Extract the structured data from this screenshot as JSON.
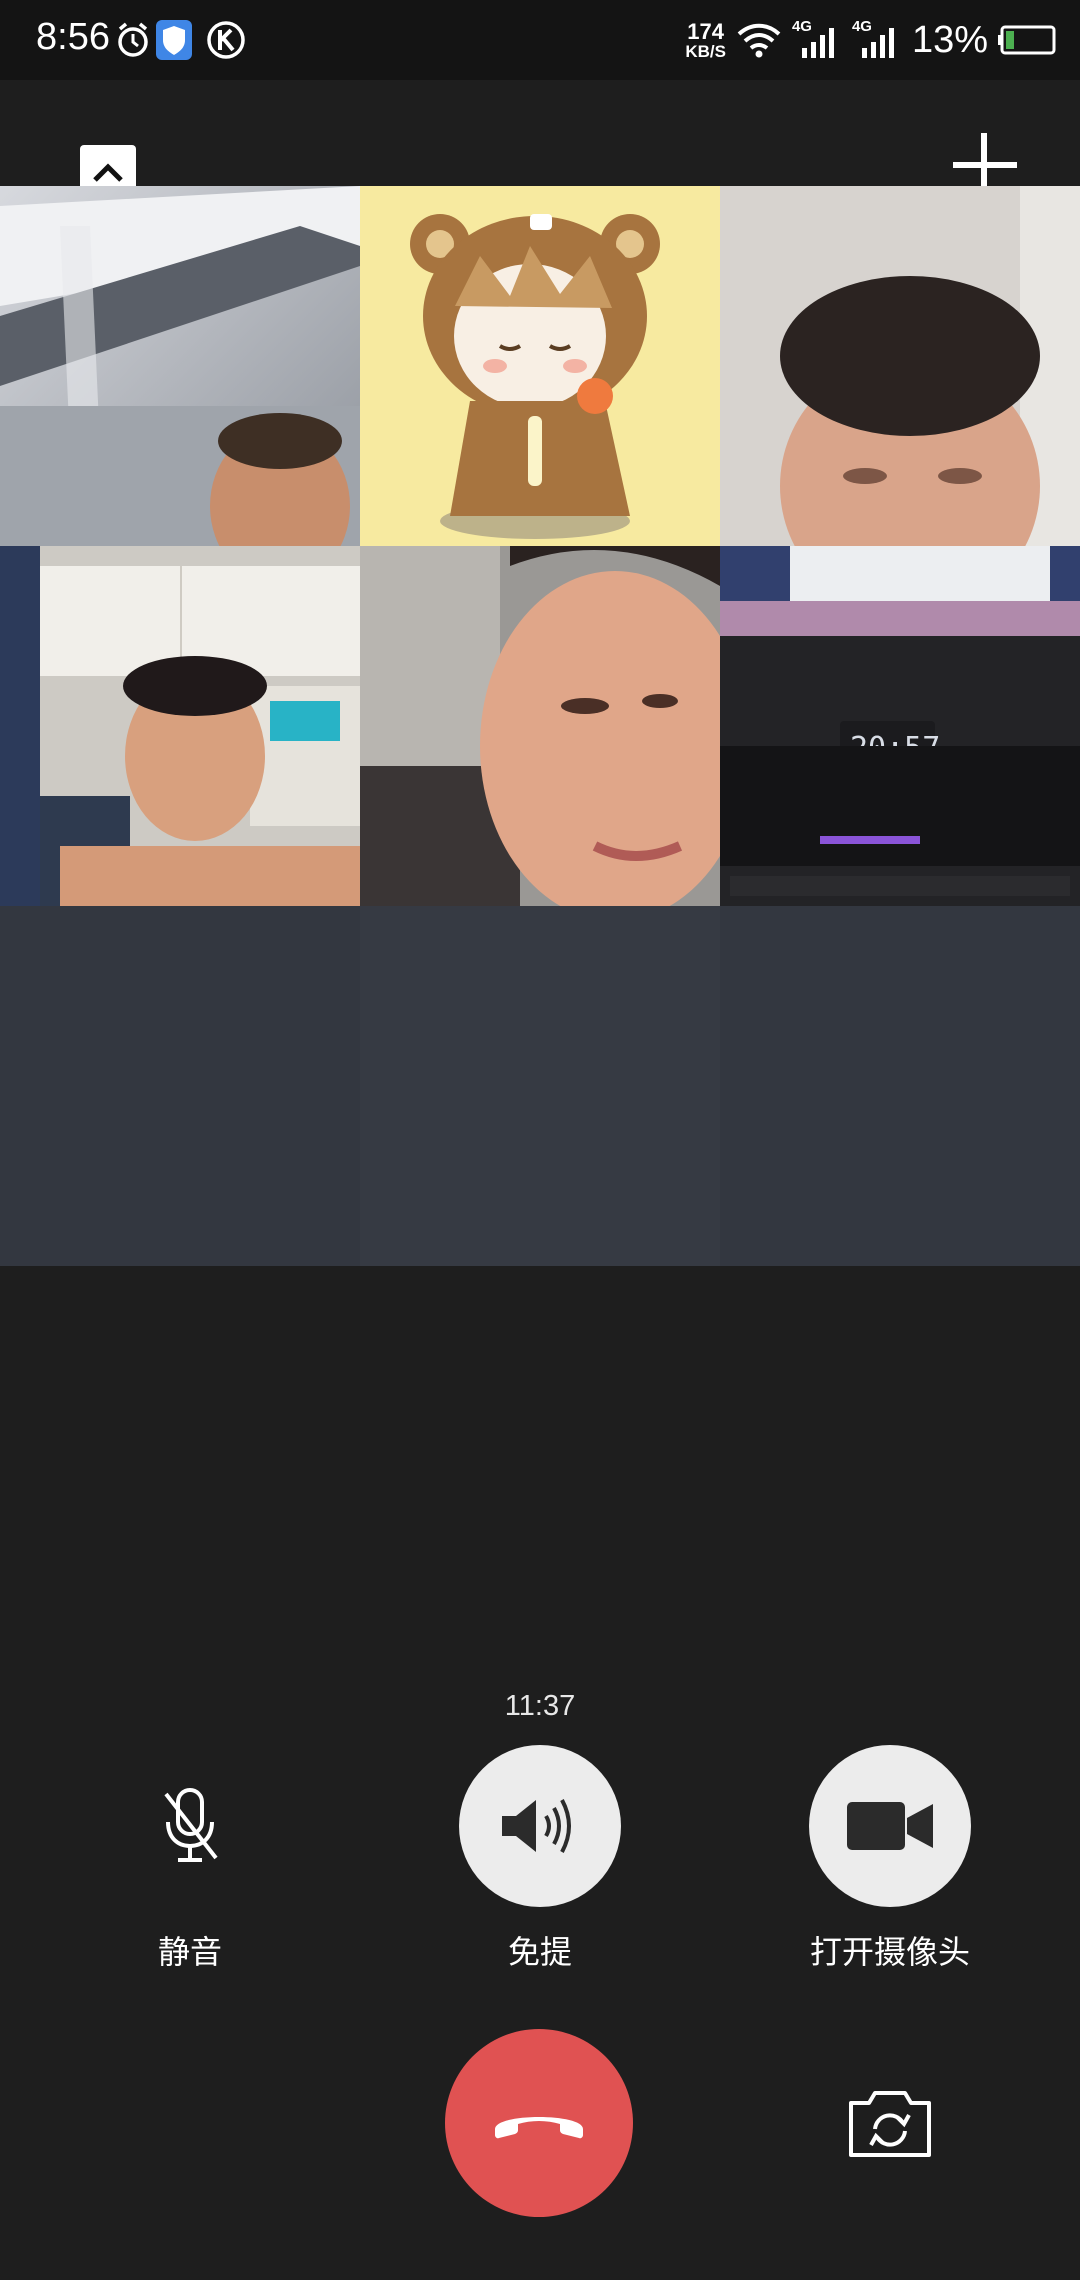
{
  "status_bar": {
    "time": "8:56",
    "network_speed_value": "174",
    "network_speed_unit": "KB/S",
    "signal_1_label": "4G",
    "signal_2_label": "4G",
    "battery_percent": "13%",
    "icons": [
      "alarm-icon",
      "shield-icon",
      "k-app-icon",
      "wifi-icon",
      "signal-icon",
      "signal-icon",
      "battery-icon"
    ]
  },
  "header": {
    "collapse_icon": "chevron-up-icon",
    "add_icon": "plus-icon"
  },
  "participants": [
    {
      "tile": "participant-video-1",
      "kind": "video"
    },
    {
      "tile": "participant-avatar-bear",
      "kind": "avatar"
    },
    {
      "tile": "participant-video-3",
      "kind": "video"
    },
    {
      "tile": "participant-video-4",
      "kind": "video"
    },
    {
      "tile": "participant-video-5",
      "kind": "video"
    },
    {
      "tile": "participant-video-6",
      "kind": "video"
    },
    {
      "tile": "empty-slot",
      "kind": "empty"
    },
    {
      "tile": "empty-slot",
      "kind": "empty"
    },
    {
      "tile": "empty-slot",
      "kind": "empty"
    }
  ],
  "call": {
    "timer": "11:37",
    "controls": {
      "mute_label": "静音",
      "speaker_label": "免提",
      "camera_label": "打开摄像头"
    },
    "hangup_icon": "hangup-icon",
    "flip_icon": "switch-camera-icon"
  },
  "colors": {
    "background": "#1e1e1e",
    "hangup": "#e05252",
    "control_fill": "#ececec",
    "empty_tile": "#333740"
  }
}
